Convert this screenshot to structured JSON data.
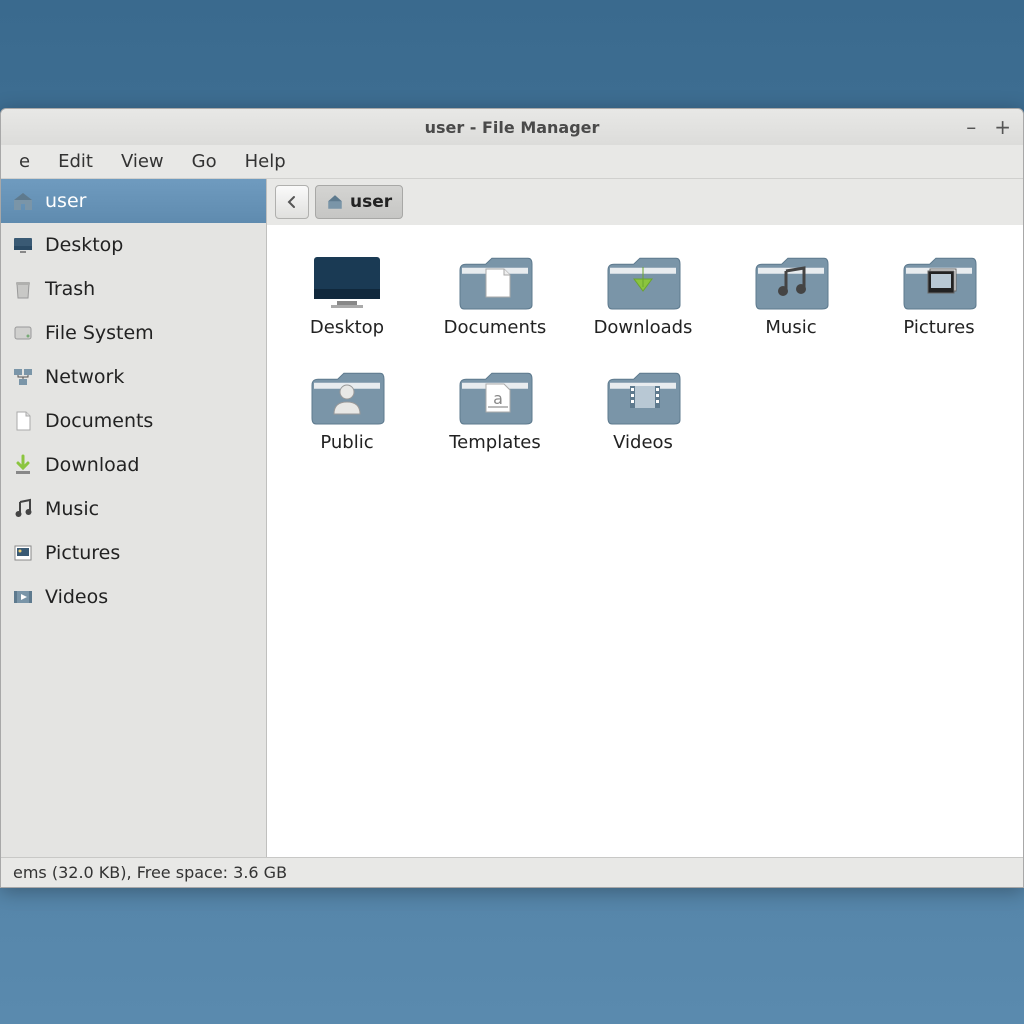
{
  "window": {
    "title": "user - File Manager"
  },
  "menu": {
    "items": [
      "e",
      "Edit",
      "View",
      "Go",
      "Help"
    ]
  },
  "breadcrumb": {
    "current": "user"
  },
  "sidebar": {
    "items": [
      {
        "label": "user",
        "icon": "home",
        "selected": true
      },
      {
        "label": "Desktop",
        "icon": "desktop",
        "selected": false
      },
      {
        "label": "Trash",
        "icon": "trash",
        "selected": false
      },
      {
        "label": "File System",
        "icon": "drive",
        "selected": false
      },
      {
        "label": "Network",
        "icon": "network",
        "selected": false
      },
      {
        "label": "Documents",
        "icon": "document",
        "selected": false
      },
      {
        "label": "Download",
        "icon": "download",
        "selected": false
      },
      {
        "label": "Music",
        "icon": "music",
        "selected": false
      },
      {
        "label": "Pictures",
        "icon": "pictures",
        "selected": false
      },
      {
        "label": "Videos",
        "icon": "videos",
        "selected": false
      }
    ]
  },
  "folders": [
    {
      "name": "Desktop",
      "icon": "desktop-big"
    },
    {
      "name": "Documents",
      "icon": "document-big"
    },
    {
      "name": "Downloads",
      "icon": "download-big"
    },
    {
      "name": "Music",
      "icon": "music-big"
    },
    {
      "name": "Pictures",
      "icon": "pictures-big"
    },
    {
      "name": "Public",
      "icon": "public-big"
    },
    {
      "name": "Templates",
      "icon": "templates-big"
    },
    {
      "name": "Videos",
      "icon": "videos-big"
    }
  ],
  "status": {
    "text": "ems (32.0 KB), Free space: 3.6 GB"
  },
  "colors": {
    "folder": "#7a95a8",
    "folder_dark": "#5e7a8e",
    "accent": "#6f9bbf",
    "download_arrow": "#8bc53f"
  }
}
